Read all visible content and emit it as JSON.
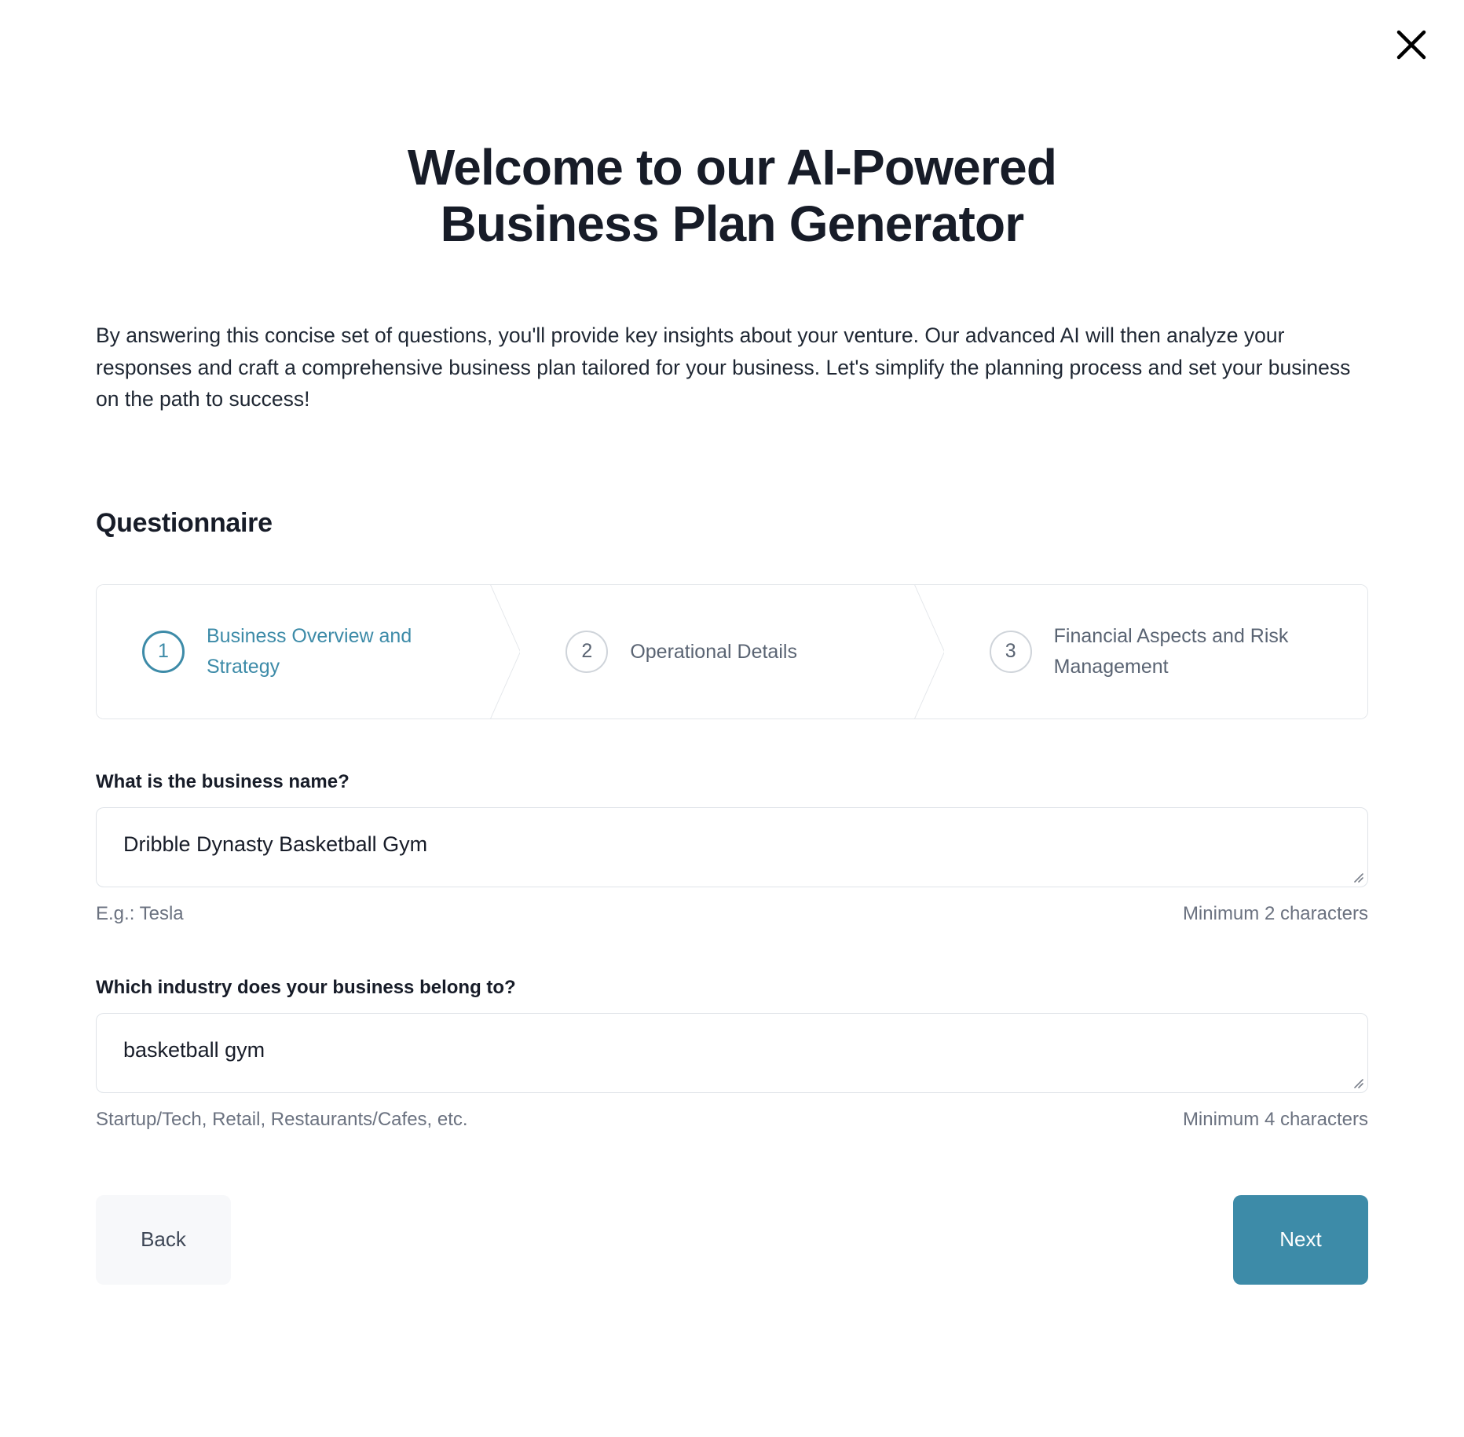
{
  "window": {
    "close_icon": "close-icon"
  },
  "header": {
    "title_line1": "Welcome to our AI-Powered",
    "title_line2": "Business Plan Generator",
    "intro": "By answering this concise set of questions, you'll provide key insights about your venture. Our advanced AI will then analyze your responses and craft a comprehensive business plan tailored for your business. Let's simplify the planning process and set your business on the path to success!"
  },
  "questionnaire": {
    "section_title": "Questionnaire",
    "active_step": 1,
    "steps": [
      {
        "number": "1",
        "label": "Business Overview and Strategy",
        "state": "active"
      },
      {
        "number": "2",
        "label": "Operational Details",
        "state": "inactive"
      },
      {
        "number": "3",
        "label": "Financial Aspects and Risk Management",
        "state": "inactive"
      }
    ],
    "fields": [
      {
        "label": "What is the business name?",
        "value": "Dribble Dynasty Basketball Gym",
        "placeholder": "",
        "hint_left": "E.g.: Tesla",
        "hint_right": "Minimum 2 characters"
      },
      {
        "label": "Which industry does your business belong to?",
        "value": "basketball gym",
        "placeholder": "",
        "hint_left": "Startup/Tech, Retail, Restaurants/Cafes, etc.",
        "hint_right": "Minimum 4 characters"
      }
    ],
    "back_label": "Back",
    "next_label": "Next"
  },
  "colors": {
    "accent": "#3d8ba8",
    "text": "#171c28",
    "muted": "#6b7280",
    "border": "#dfe3e8",
    "back_bg": "#f7f8fa"
  }
}
